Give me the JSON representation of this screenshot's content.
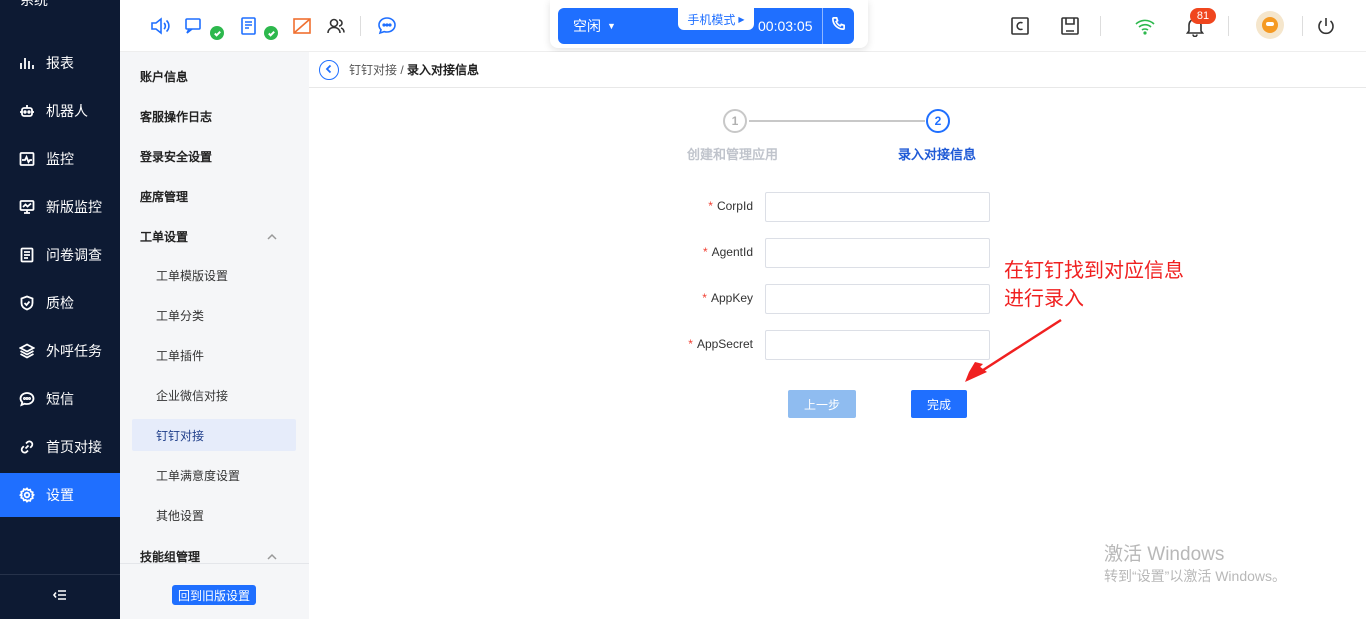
{
  "nav": {
    "brand": "系统",
    "items": [
      {
        "label": "报表",
        "icon": "bar-chart-icon"
      },
      {
        "label": "机器人",
        "icon": "robot-icon"
      },
      {
        "label": "监控",
        "icon": "pulse-monitor-icon"
      },
      {
        "label": "新版监控",
        "icon": "desktop-monitor-icon"
      },
      {
        "label": "问卷调查",
        "icon": "survey-icon"
      },
      {
        "label": "质检",
        "icon": "shield-check-icon"
      },
      {
        "label": "外呼任务",
        "icon": "layers-icon"
      },
      {
        "label": "短信",
        "icon": "chat-bubble-icon"
      },
      {
        "label": "首页对接",
        "icon": "link-icon"
      },
      {
        "label": "设置",
        "icon": "gear-icon"
      }
    ],
    "active_index": 9,
    "collapse_icon": "collapse-menu-icon"
  },
  "topbar": {
    "icons": [
      "speaker-icon",
      "message-icon",
      "sms-form-icon",
      "no-image-icon",
      "users-icon",
      "chat-service-icon"
    ],
    "status_label": "空闲",
    "mode_label": "手机模式",
    "timer": "00:03:05",
    "right_icons": [
      "c-box-icon",
      "save-icon",
      "wifi-icon",
      "bell-icon",
      "power-icon"
    ],
    "notification_count": "81",
    "colors": {
      "accent": "#1f6fff",
      "badge": "#f0461e",
      "check": "#2db84d"
    }
  },
  "submenu": {
    "items": [
      {
        "label": "账户信息"
      },
      {
        "label": "客服操作日志"
      },
      {
        "label": "登录安全设置"
      },
      {
        "label": "座席管理"
      },
      {
        "label": "工单设置"
      },
      {
        "label": "工单模版设置"
      },
      {
        "label": "工单分类"
      },
      {
        "label": "工单插件"
      },
      {
        "label": "企业微信对接"
      },
      {
        "label": "钉钉对接"
      },
      {
        "label": "工单满意度设置"
      },
      {
        "label": "其他设置"
      },
      {
        "label": "技能组管理"
      }
    ],
    "selected_index": 9,
    "old_settings_button": "回到旧版设置"
  },
  "breadcrumb": {
    "parent": "钉钉对接",
    "separator": " / ",
    "current": "录入对接信息"
  },
  "steps": [
    {
      "number": "1",
      "label": "创建和管理应用",
      "state": "done"
    },
    {
      "number": "2",
      "label": "录入对接信息",
      "state": "active"
    }
  ],
  "form": {
    "required_mark": "*",
    "fields": [
      {
        "label": "CorpId",
        "value": "",
        "placeholder": ""
      },
      {
        "label": "AgentId",
        "value": "",
        "placeholder": ""
      },
      {
        "label": "AppKey",
        "value": "",
        "placeholder": ""
      },
      {
        "label": "AppSecret",
        "value": "",
        "placeholder": ""
      }
    ],
    "prev_button": "上一步",
    "finish_button": "完成"
  },
  "annotation": {
    "line1": "在钉钉找到对应信息",
    "line2": "进行录入",
    "color": "#f02020"
  },
  "watermark": {
    "title": "激活 Windows",
    "subtitle": "转到“设置”以激活 Windows。"
  }
}
